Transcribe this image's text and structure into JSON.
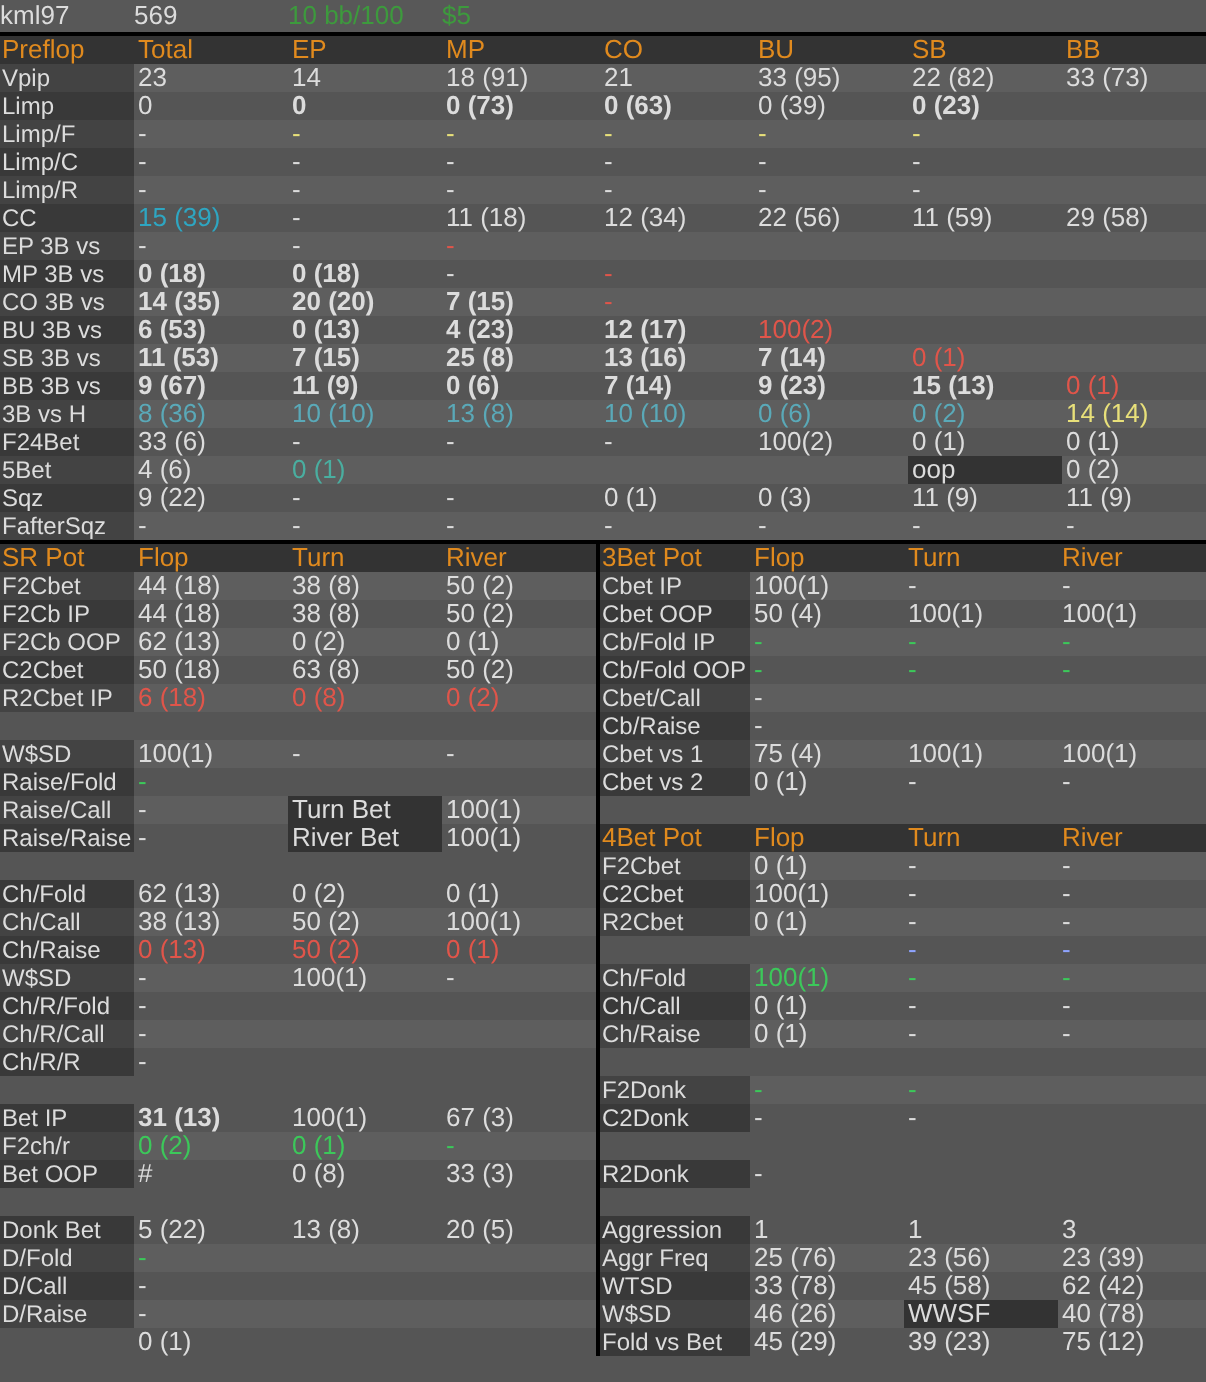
{
  "player_bar": {
    "player": "kml97",
    "hands": "569",
    "winrate": "10 bb/100",
    "winnings": "$5"
  },
  "preflop": {
    "rows": [
      {
        "kind": "heading",
        "label": "Preflop",
        "cells": [
          "Total",
          "EP",
          "MP",
          "CO",
          "BU",
          "SB",
          "BB"
        ]
      },
      {
        "kind": "stat",
        "label": "Vpip",
        "cells": [
          "23",
          "14",
          "18 (91)",
          "21",
          "33 (95)",
          "22 (82)",
          "33 (73)"
        ]
      },
      {
        "kind": "stat",
        "label": "Limp",
        "cells": [
          "0",
          {
            "text": "0",
            "bold": true
          },
          {
            "text": "0 (73)",
            "bold": true
          },
          {
            "text": "0 (63)",
            "bold": true
          },
          "0 (39)",
          {
            "text": "0 (23)",
            "bold": true
          }
        ]
      },
      {
        "kind": "stat",
        "label": "Limp/F",
        "cells": [
          "-",
          {
            "text": "-",
            "color": "#e8e07a"
          },
          {
            "text": "-",
            "color": "#e8e07a"
          },
          {
            "text": "-",
            "color": "#e8e07a"
          },
          {
            "text": "-",
            "color": "#e8e07a"
          },
          {
            "text": "-",
            "color": "#e8e07a"
          }
        ]
      },
      {
        "kind": "stat",
        "label": "Limp/C",
        "cells": [
          "-",
          "-",
          "-",
          "-",
          "-",
          "-"
        ]
      },
      {
        "kind": "stat",
        "label": "Limp/R",
        "cells": [
          "-",
          "-",
          "-",
          "-",
          "-",
          "-"
        ]
      },
      {
        "kind": "stat",
        "label": "CC",
        "cells": [
          {
            "text": "15 (39)",
            "color": "#2ea6c2"
          },
          "-",
          "11 (18)",
          "12 (34)",
          "22 (56)",
          "11 (59)",
          "29 (58)"
        ]
      },
      {
        "kind": "stat",
        "label": "EP 3B vs",
        "cells": [
          "-",
          "-",
          {
            "text": "-",
            "color": "#e0554a"
          }
        ]
      },
      {
        "kind": "stat",
        "label": "MP 3B vs",
        "cells": [
          {
            "text": "0 (18)",
            "bold": true
          },
          {
            "text": "0 (18)",
            "bold": true
          },
          "-",
          {
            "text": "-",
            "color": "#e0554a"
          }
        ]
      },
      {
        "kind": "stat",
        "label": "CO 3B vs",
        "cells": [
          {
            "text": "14 (35)",
            "bold": true
          },
          {
            "text": "20 (20)",
            "bold": true
          },
          {
            "text": "7 (15)",
            "bold": true
          },
          {
            "text": "-",
            "color": "#e0554a"
          }
        ]
      },
      {
        "kind": "stat",
        "label": "BU 3B vs",
        "cells": [
          {
            "text": "6 (53)",
            "bold": true
          },
          {
            "text": "0 (13)",
            "bold": true
          },
          {
            "text": "4 (23)",
            "bold": true
          },
          {
            "text": "12 (17)",
            "bold": true
          },
          {
            "text": "100(2)",
            "color": "#e0554a"
          }
        ]
      },
      {
        "kind": "stat",
        "label": "SB 3B vs",
        "cells": [
          {
            "text": "11 (53)",
            "bold": true
          },
          {
            "text": "7 (15)",
            "bold": true
          },
          {
            "text": "25 (8)",
            "bold": true
          },
          {
            "text": "13 (16)",
            "bold": true
          },
          {
            "text": "7 (14)",
            "bold": true
          },
          {
            "text": "0 (1)",
            "color": "#e0554a"
          }
        ]
      },
      {
        "kind": "stat",
        "label": "BB 3B vs",
        "cells": [
          {
            "text": "9 (67)",
            "bold": true
          },
          {
            "text": "11 (9)",
            "bold": true
          },
          {
            "text": "0 (6)",
            "bold": true
          },
          {
            "text": "7 (14)",
            "bold": true
          },
          {
            "text": "9 (23)",
            "bold": true
          },
          {
            "text": "15 (13)",
            "bold": true
          },
          {
            "text": "0 (1)",
            "color": "#e0554a"
          }
        ]
      },
      {
        "kind": "stat",
        "label": "3B vs H",
        "cells": [
          {
            "text": "8 (36)",
            "color": "#5aa9b8"
          },
          {
            "text": "10 (10)",
            "color": "#5aa9b8"
          },
          {
            "text": "13 (8)",
            "color": "#5aa9b8"
          },
          {
            "text": "10 (10)",
            "color": "#5aa9b8"
          },
          {
            "text": "0 (6)",
            "color": "#5aa9b8"
          },
          {
            "text": "0 (2)",
            "color": "#5aa9b8"
          },
          {
            "text": "14 (14)",
            "color": "#e8e07a"
          }
        ]
      },
      {
        "kind": "stat",
        "label": "F24Bet",
        "cells": [
          "33 (6)",
          "-",
          "-",
          "-",
          "100(2)",
          "0 (1)",
          "0 (1)"
        ]
      },
      {
        "kind": "stat",
        "label": "5Bet",
        "cells": [
          "4 (6)",
          {
            "text": "0 (1)",
            "color": "#4aaea0"
          },
          null,
          null,
          null,
          {
            "text": "oop",
            "kind": "label"
          },
          "0 (2)"
        ]
      },
      {
        "kind": "stat",
        "label": "Sqz",
        "cells": [
          "9 (22)",
          "-",
          "-",
          "0 (1)",
          "0 (3)",
          "11 (9)",
          "11 (9)"
        ]
      },
      {
        "kind": "stat",
        "label": "FafterSqz",
        "cells": [
          "-",
          "-",
          "-",
          "-",
          "-",
          "-",
          "-"
        ]
      }
    ]
  },
  "sr_pot": {
    "rows": [
      {
        "kind": "heading",
        "label": "SR Pot",
        "cells": [
          "Flop",
          "Turn",
          "River"
        ]
      },
      {
        "kind": "stat",
        "label": "F2Cbet",
        "cells": [
          "44 (18)",
          "38 (8)",
          "50 (2)"
        ]
      },
      {
        "kind": "stat",
        "label": "F2Cb IP",
        "cells": [
          "44 (18)",
          "38 (8)",
          "50 (2)"
        ]
      },
      {
        "kind": "stat",
        "label": "F2Cb OOP",
        "cells": [
          "62 (13)",
          "0 (2)",
          "0 (1)"
        ]
      },
      {
        "kind": "stat",
        "label": "C2Cbet",
        "cells": [
          "50 (18)",
          "63 (8)",
          "50 (2)"
        ]
      },
      {
        "kind": "stat",
        "label": "R2Cbet IP",
        "cells": [
          {
            "text": "6 (18)",
            "color": "#e0554a"
          },
          {
            "text": "0 (8)",
            "color": "#e0554a"
          },
          {
            "text": "0 (2)",
            "color": "#e0554a"
          }
        ]
      },
      {
        "kind": "spacer"
      },
      {
        "kind": "stat",
        "label": "W$SD",
        "cells": [
          "100(1)",
          "-",
          "-"
        ]
      },
      {
        "kind": "stat",
        "label": "Raise/Fold",
        "cells": [
          {
            "text": "-",
            "color": "#3cc85a"
          }
        ]
      },
      {
        "kind": "stat",
        "label": "Raise/Call",
        "cells": [
          "-",
          {
            "text": "Turn Bet",
            "kind": "label"
          },
          "100(1)"
        ]
      },
      {
        "kind": "stat",
        "label": "Raise/Raise",
        "cells": [
          "-",
          {
            "text": "River Bet",
            "kind": "label"
          },
          "100(1)"
        ]
      },
      {
        "kind": "spacer"
      },
      {
        "kind": "stat",
        "label": "Ch/Fold",
        "cells": [
          "62 (13)",
          "0 (2)",
          "0 (1)"
        ]
      },
      {
        "kind": "stat",
        "label": "Ch/Call",
        "cells": [
          "38 (13)",
          "50 (2)",
          "100(1)"
        ]
      },
      {
        "kind": "stat",
        "label": "Ch/Raise",
        "cells": [
          {
            "text": "0 (13)",
            "color": "#e0554a"
          },
          {
            "text": "50 (2)",
            "color": "#e0554a"
          },
          {
            "text": "0 (1)",
            "color": "#e0554a"
          }
        ]
      },
      {
        "kind": "stat",
        "label": "W$SD",
        "cells": [
          "-",
          "100(1)",
          "-"
        ]
      },
      {
        "kind": "stat",
        "label": "Ch/R/Fold",
        "cells": [
          "-"
        ]
      },
      {
        "kind": "stat",
        "label": "Ch/R/Call",
        "cells": [
          "-"
        ]
      },
      {
        "kind": "stat",
        "label": "Ch/R/R",
        "cells": [
          "-"
        ]
      },
      {
        "kind": "spacer"
      },
      {
        "kind": "stat",
        "label": "Bet IP",
        "cells": [
          {
            "text": "31 (13)",
            "bold": true
          },
          "100(1)",
          "67 (3)"
        ]
      },
      {
        "kind": "stat",
        "label": "F2ch/r",
        "cells": [
          {
            "text": "0 (2)",
            "color": "#3cc85a"
          },
          {
            "text": "0 (1)",
            "color": "#3cc85a"
          },
          {
            "text": "-",
            "color": "#3cc85a"
          }
        ]
      },
      {
        "kind": "stat",
        "label": "Bet OOP",
        "cells": [
          "#",
          "0 (8)",
          "33 (3)"
        ]
      },
      {
        "kind": "spacer"
      },
      {
        "kind": "stat",
        "label": "Donk Bet",
        "cells": [
          "5 (22)",
          "13 (8)",
          "20 (5)"
        ]
      },
      {
        "kind": "stat",
        "label": "D/Fold",
        "cells": [
          {
            "text": "-",
            "color": "#3cc85a"
          }
        ]
      },
      {
        "kind": "stat",
        "label": "D/Call",
        "cells": [
          "-"
        ]
      },
      {
        "kind": "stat",
        "label": "D/Raise",
        "cells": [
          "-"
        ]
      },
      {
        "kind": "stat",
        "cells": [
          "0 (1)"
        ]
      }
    ]
  },
  "three_bet_pot": {
    "rows": [
      {
        "kind": "heading",
        "label": "3Bet Pot",
        "cells": [
          "Flop",
          "Turn",
          "River"
        ]
      },
      {
        "kind": "stat",
        "label": "Cbet IP",
        "cells": [
          "100(1)",
          "-",
          "-"
        ]
      },
      {
        "kind": "stat",
        "label": "Cbet OOP",
        "cells": [
          "50 (4)",
          "100(1)",
          "100(1)"
        ]
      },
      {
        "kind": "stat",
        "label": "Cb/Fold IP",
        "cells": [
          {
            "text": "-",
            "color": "#3cc85a"
          },
          {
            "text": "-",
            "color": "#3cc85a"
          },
          {
            "text": "-",
            "color": "#3cc85a"
          }
        ]
      },
      {
        "kind": "stat",
        "label": "Cb/Fold OOP",
        "cells": [
          {
            "text": "-",
            "color": "#3cc85a"
          },
          {
            "text": "-",
            "color": "#3cc85a"
          },
          {
            "text": "-",
            "color": "#3cc85a"
          }
        ]
      },
      {
        "kind": "stat",
        "label": "Cbet/Call",
        "cells": [
          "-"
        ]
      },
      {
        "kind": "stat",
        "label": "Cb/Raise",
        "cells": [
          "-"
        ]
      },
      {
        "kind": "stat",
        "label": "Cbet vs 1",
        "cells": [
          "75 (4)",
          "100(1)",
          "100(1)"
        ]
      },
      {
        "kind": "stat",
        "label": "Cbet vs 2",
        "cells": [
          "0 (1)",
          "-",
          "-"
        ]
      },
      {
        "kind": "spacer"
      },
      {
        "kind": "heading",
        "label": "4Bet Pot",
        "cells": [
          "Flop",
          "Turn",
          "River"
        ]
      },
      {
        "kind": "stat",
        "label": "F2Cbet",
        "cells": [
          "0 (1)",
          "-",
          "-"
        ]
      },
      {
        "kind": "stat",
        "label": "C2Cbet",
        "cells": [
          "100(1)",
          "-",
          "-"
        ]
      },
      {
        "kind": "stat",
        "label": "R2Cbet",
        "cells": [
          "0 (1)",
          "-",
          "-"
        ]
      },
      {
        "kind": "stat",
        "cells": [
          null,
          {
            "text": "-",
            "color": "#8fa4ff"
          },
          {
            "text": "-",
            "color": "#8fa4ff"
          }
        ]
      },
      {
        "kind": "stat",
        "label": "Ch/Fold",
        "cells": [
          {
            "text": "100(1)",
            "color": "#3cc85a"
          },
          {
            "text": "-",
            "color": "#3cc85a"
          },
          {
            "text": "-",
            "color": "#3cc85a"
          }
        ]
      },
      {
        "kind": "stat",
        "label": "Ch/Call",
        "cells": [
          "0 (1)",
          "-",
          "-"
        ]
      },
      {
        "kind": "stat",
        "label": "Ch/Raise",
        "cells": [
          "0 (1)",
          "-",
          "-"
        ]
      },
      {
        "kind": "spacer"
      },
      {
        "kind": "stat",
        "label": "F2Donk",
        "cells": [
          {
            "text": "-",
            "color": "#3cc85a"
          },
          {
            "text": "-",
            "color": "#3cc85a"
          }
        ]
      },
      {
        "kind": "stat",
        "label": "C2Donk",
        "cells": [
          "-",
          "-"
        ]
      },
      {
        "kind": "spacer"
      },
      {
        "kind": "stat",
        "label": "R2Donk",
        "cells": [
          "-"
        ]
      },
      {
        "kind": "spacer"
      },
      {
        "kind": "stat",
        "label": "Aggression",
        "cells": [
          "1",
          "1",
          "3"
        ]
      },
      {
        "kind": "stat",
        "label": "Aggr Freq",
        "cells": [
          "25 (76)",
          "23 (56)",
          "23 (39)"
        ]
      },
      {
        "kind": "stat",
        "label": "WTSD",
        "cells": [
          "33 (78)",
          "45 (58)",
          "62 (42)"
        ]
      },
      {
        "kind": "stat",
        "label": "W$SD",
        "cells": [
          "46 (26)",
          {
            "text": "WWSF",
            "kind": "label"
          },
          "40 (78)"
        ]
      },
      {
        "kind": "stat",
        "label": "Fold vs Bet",
        "cells": [
          "45 (29)",
          "39 (23)",
          "75 (12)"
        ]
      }
    ]
  }
}
